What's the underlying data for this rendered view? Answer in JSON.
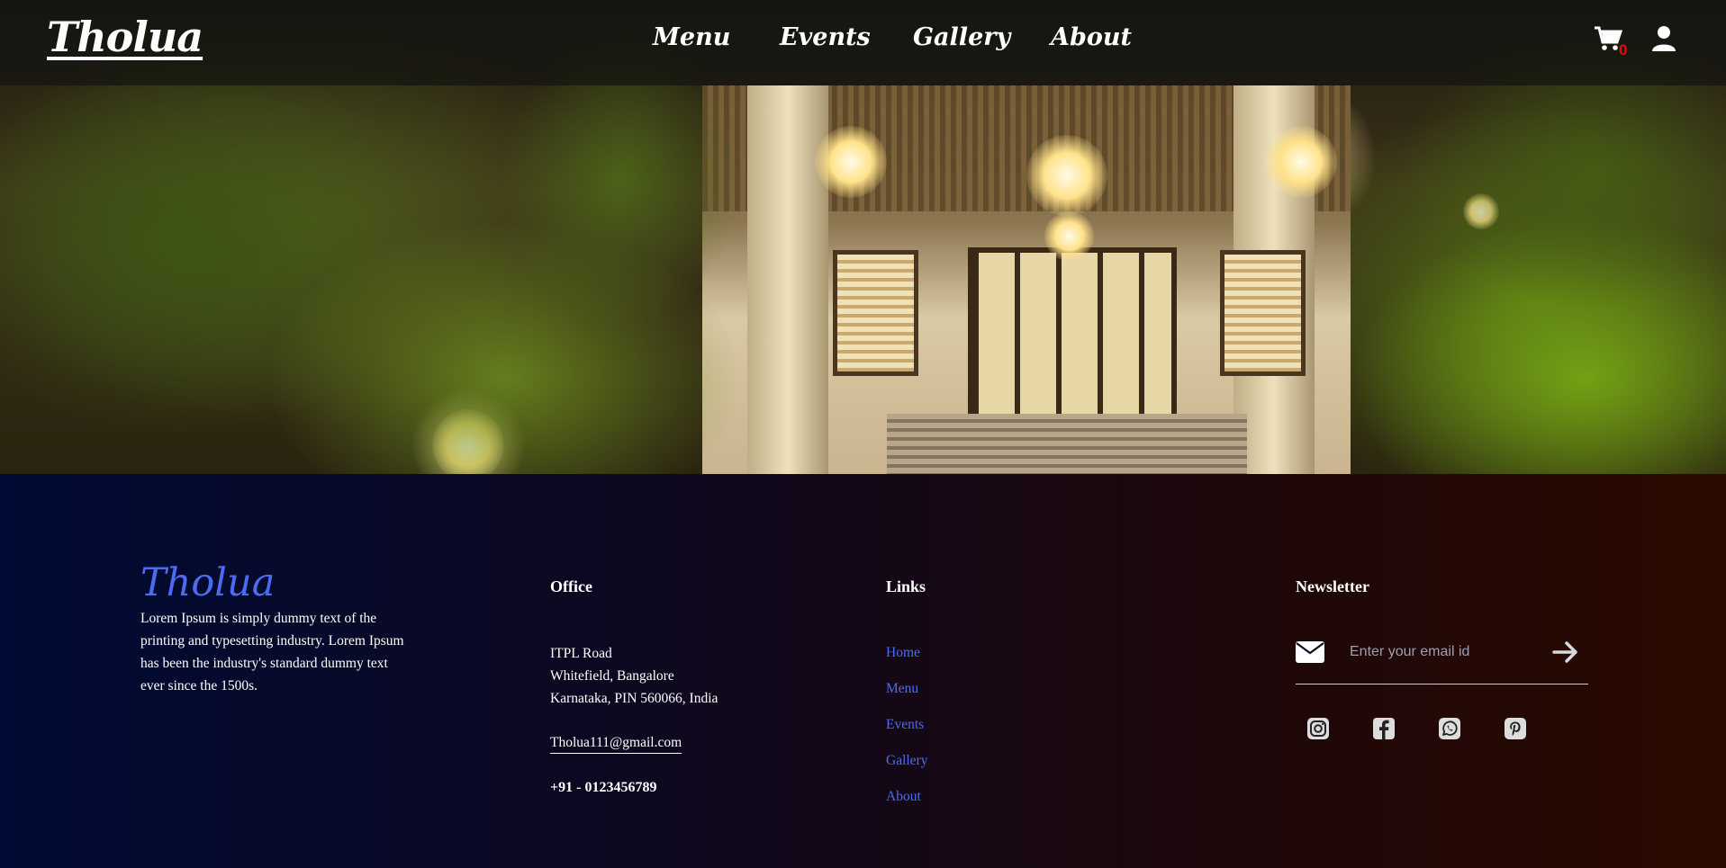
{
  "header": {
    "logo": "Tholua",
    "nav": [
      {
        "label": "Menu"
      },
      {
        "label": "Events"
      },
      {
        "label": "Gallery"
      },
      {
        "label": "About"
      }
    ],
    "cart_count": "0",
    "icons": {
      "cart": "cart-icon",
      "user": "user-icon"
    }
  },
  "footer": {
    "brand": "Tholua",
    "description": "Lorem Ipsum is simply dummy text of the printing and typesetting industry. Lorem Ipsum has been the industry's standard dummy text ever since the 1500s.",
    "office": {
      "heading": "Office",
      "address_lines": [
        "ITPL Road",
        "Whitefield, Bangalore",
        "Karnataka, PIN 560066, India"
      ],
      "email": "Tholua111@gmail.com",
      "phone": "+91 - 0123456789"
    },
    "links": {
      "heading": "Links",
      "items": [
        "Home",
        "Menu",
        "Events",
        "Gallery",
        "About"
      ]
    },
    "newsletter": {
      "heading": "Newsletter",
      "placeholder": "Enter your email id",
      "icons": [
        "envelope-icon",
        "arrow-right-icon"
      ],
      "social": [
        "instagram-icon",
        "facebook-icon",
        "whatsapp-icon",
        "pinterest-icon"
      ]
    }
  },
  "colors": {
    "accent_blue": "#4d6bf0",
    "cart_badge": "#e01010",
    "footer_left": "#000b35",
    "footer_right": "#2a0a00"
  }
}
